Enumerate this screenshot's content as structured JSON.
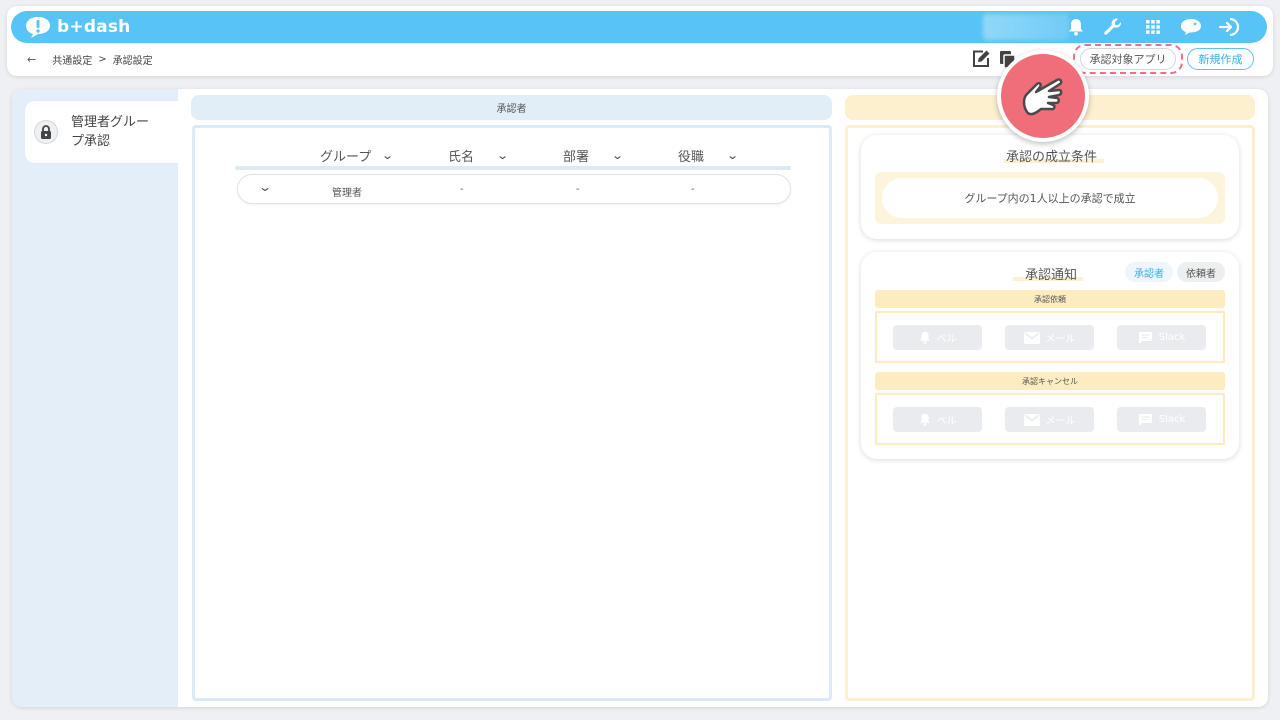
{
  "brand": {
    "logo_text": "b+dash",
    "primary_color": "#58c3f6",
    "accent_pink": "#ec7086"
  },
  "topbar": {
    "icons": [
      "bell-icon",
      "wrench-icon",
      "grid-icon",
      "chat-icon",
      "logout-icon"
    ]
  },
  "breadcrumb": {
    "back": "←",
    "parent": "共通設定",
    "separator": ">",
    "current": "承認設定"
  },
  "toolbar": {
    "target_apps_label": "承認対象アプリ",
    "new_label": "新規作成",
    "icons": [
      "edit-icon",
      "copy-icon"
    ]
  },
  "sidebar": {
    "items": [
      {
        "label": "管理者グループ承認",
        "icon": "lock-icon",
        "selected": true
      }
    ]
  },
  "approvers": {
    "header": "承認者",
    "columns": [
      "グループ",
      "氏名",
      "部署",
      "役職"
    ],
    "rows": [
      {
        "group": "管理者",
        "name": "-",
        "department": "-",
        "position": "-"
      }
    ]
  },
  "settings": {
    "condition": {
      "title": "承認の成立条件",
      "value": "グループ内の1人以上の承認で成立"
    },
    "notification": {
      "title": "承認通知",
      "tabs": [
        {
          "label": "承認者",
          "active": true
        },
        {
          "label": "依頼者",
          "active": false
        }
      ],
      "sections": [
        {
          "title": "承認依頼",
          "channels": [
            "ベル",
            "メール",
            "Slack"
          ]
        },
        {
          "title": "承認キャンセル",
          "channels": [
            "ベル",
            "メール",
            "Slack"
          ]
        }
      ]
    }
  }
}
